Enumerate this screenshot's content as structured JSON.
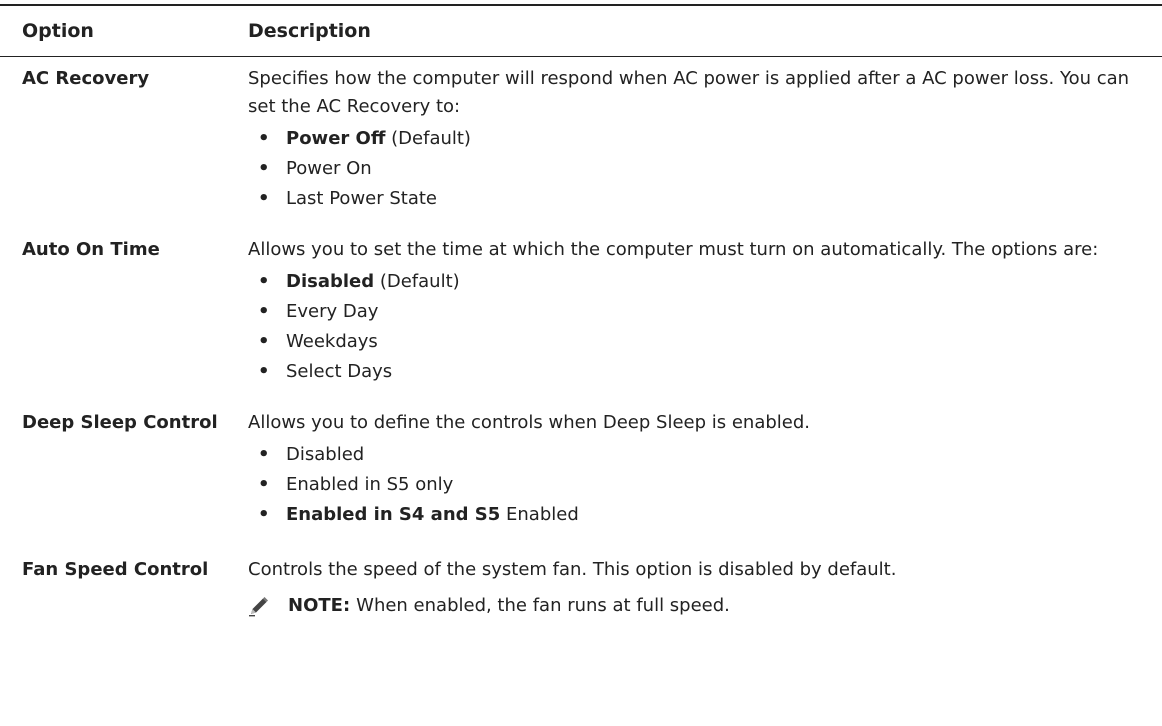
{
  "table": {
    "header": {
      "option": "Option",
      "description": "Description"
    },
    "rows": [
      {
        "option": "AC Recovery",
        "description": "Specifies how the computer will respond when AC power is applied after a AC power loss. You can set the AC Recovery to:",
        "items": [
          {
            "bold": "Power Off",
            "rest": " (Default)"
          },
          {
            "bold": "",
            "rest": "Power On"
          },
          {
            "bold": "",
            "rest": "Last Power State"
          }
        ]
      },
      {
        "option": "Auto On Time",
        "description": "Allows you to set the time at which the computer must turn on automatically. The options are:",
        "items": [
          {
            "bold": "Disabled",
            "rest": " (Default)"
          },
          {
            "bold": "",
            "rest": "Every Day"
          },
          {
            "bold": "",
            "rest": "Weekdays"
          },
          {
            "bold": "",
            "rest": "Select Days"
          }
        ]
      },
      {
        "option": "Deep Sleep Control",
        "description": "Allows you to define the controls when Deep Sleep is enabled.",
        "items": [
          {
            "bold": "",
            "rest": "Disabled"
          },
          {
            "bold": "",
            "rest": "Enabled in S5 only"
          },
          {
            "bold": "Enabled in S4 and S5",
            "rest": " Enabled"
          }
        ]
      },
      {
        "option": "Fan Speed Control",
        "description": "Controls the speed of the system fan. This option is disabled by default.",
        "note_label": "NOTE:",
        "note_text": "When enabled, the fan runs at full speed.",
        "note_icon": "pencil-note-icon"
      }
    ]
  },
  "bullet_glyph": "•"
}
